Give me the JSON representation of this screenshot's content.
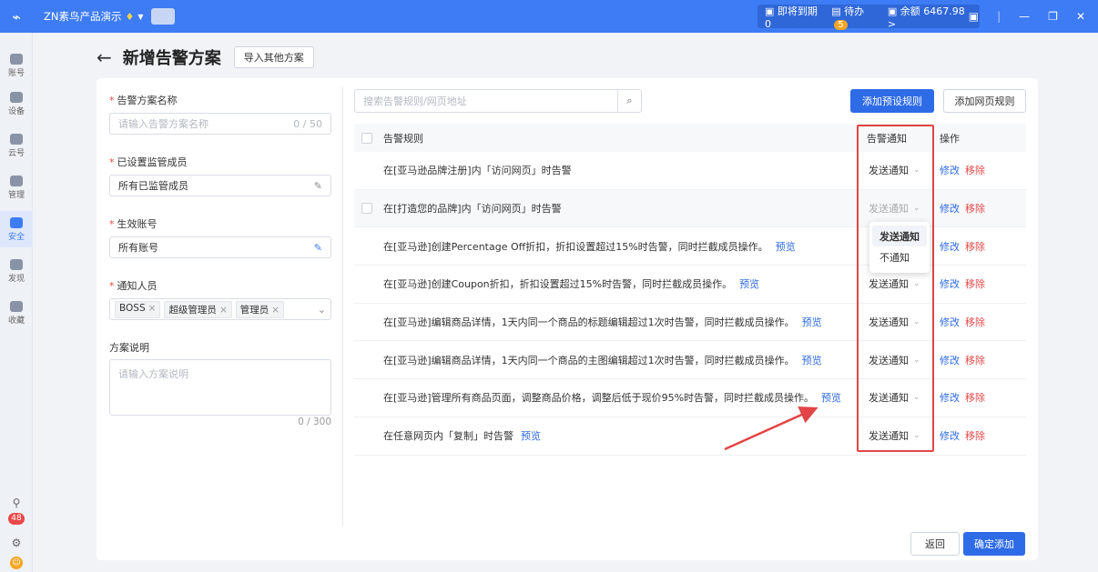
{
  "topbar": {
    "logo": "⌁",
    "app_name": "ZN素鸟产品演示",
    "expiring_label": "即将到期",
    "expiring_count": "0",
    "todo_label": "待办",
    "todo_count": "5",
    "balance_label": "余额",
    "balance_value": "6467.98",
    "balance_chevron": ">"
  },
  "sidebar": {
    "items": [
      {
        "label": "账号"
      },
      {
        "label": "设备"
      },
      {
        "label": "云号"
      },
      {
        "label": "管理"
      },
      {
        "label": "安全"
      },
      {
        "label": "发现"
      },
      {
        "label": "收藏"
      }
    ],
    "badge_count": "48"
  },
  "header": {
    "title": "新增告警方案",
    "import_button": "导入其他方案"
  },
  "form": {
    "name_label": "告警方案名称",
    "name_placeholder": "请输入告警方案名称",
    "name_counter": "0 / 50",
    "members_label": "已设置监管成员",
    "members_value": "所有已监管成员",
    "accounts_label": "生效账号",
    "accounts_value": "所有账号",
    "notify_label": "通知人员",
    "notify_tags": [
      "BOSS",
      "超级管理员",
      "管理员"
    ],
    "desc_label": "方案说明",
    "desc_placeholder": "请输入方案说明",
    "desc_counter": "0 / 300"
  },
  "rules": {
    "search_placeholder": "搜索告警规则/网页地址",
    "add_preset_button": "添加预设规则",
    "add_page_button": "添加网页规则",
    "col_rule": "告警规则",
    "col_notify": "告警通知",
    "col_ops": "操作",
    "rows": [
      {
        "text": "在[亚马逊品牌注册]内「访问网页」时告警",
        "preview": "",
        "notify": "发送通知"
      },
      {
        "text": "在[打造您的品牌]内「访问网页」时告警",
        "preview": "",
        "notify": "发送通知"
      },
      {
        "text": "在[亚马逊]创建Percentage Off折扣，折扣设置超过15%时告警，同时拦截成员操作。",
        "preview": "预览",
        "notify": "发送通知"
      },
      {
        "text": "在[亚马逊]创建Coupon折扣，折扣设置超过15%时告警，同时拦截成员操作。",
        "preview": "预览",
        "notify": "发送通知"
      },
      {
        "text": "在[亚马逊]编辑商品详情，1天内同一个商品的标题编辑超过1次时告警，同时拦截成员操作。",
        "preview": "预览",
        "notify": "发送通知"
      },
      {
        "text": "在[亚马逊]编辑商品详情，1天内同一个商品的主图编辑超过1次时告警，同时拦截成员操作。",
        "preview": "预览",
        "notify": "发送通知"
      },
      {
        "text": "在[亚马逊]管理所有商品页面，调整商品价格，调整后低于现价95%时告警，同时拦截成员操作。",
        "preview": "预览",
        "notify": "发送通知"
      },
      {
        "text": "在任意网页内「复制」时告警",
        "preview": "预览",
        "notify": "发送通知"
      }
    ],
    "edit_label": "修改",
    "remove_label": "移除",
    "dropdown_options": [
      "发送通知",
      "不通知"
    ]
  },
  "footer": {
    "back_button": "返回",
    "confirm_button": "确定添加"
  },
  "colors": {
    "accent": "#3d7cf4",
    "primary_button": "#2e6be6",
    "danger": "#e94848",
    "highlight_box": "#e24545"
  }
}
